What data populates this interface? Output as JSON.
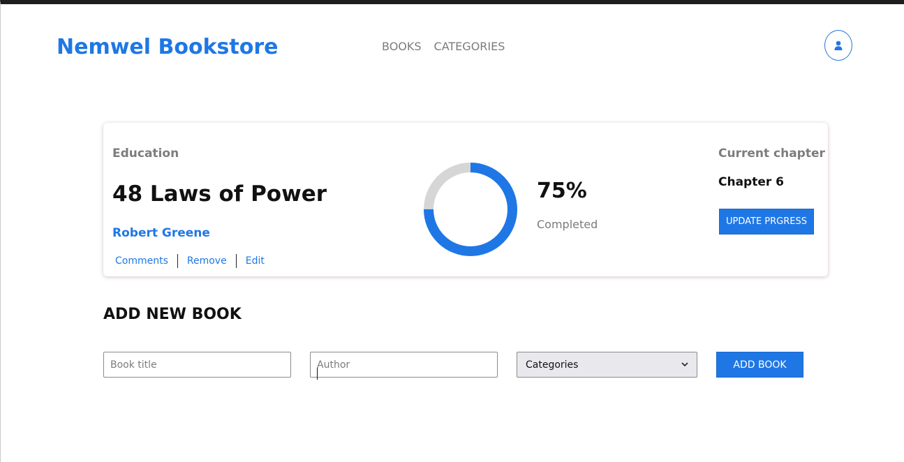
{
  "header": {
    "brand": "Nemwel Bookstore",
    "nav": [
      {
        "label": "BOOKS"
      },
      {
        "label": "CATEGORIES"
      }
    ],
    "user_icon": "user-icon"
  },
  "book": {
    "genre": "Education",
    "title": "48 Laws of Power",
    "author": "Robert Greene",
    "actions": [
      "Comments",
      "Remove",
      "Edit"
    ],
    "progress": {
      "value": 0.75,
      "percent_label": "75%",
      "status": "Completed"
    },
    "current_chapter_label": "Current chapter",
    "current_chapter": "Chapter 6",
    "update_label": "UPDATE PRGRESS"
  },
  "form": {
    "title": "ADD NEW BOOK",
    "book_title_placeholder": "Book title",
    "author_placeholder": "Author",
    "category_selected": "Categories",
    "submit_label": "ADD BOOK"
  },
  "colors": {
    "accent": "#1f77e5",
    "ring_track": "#d6d6d6",
    "muted_text": "#7b7b7b"
  }
}
